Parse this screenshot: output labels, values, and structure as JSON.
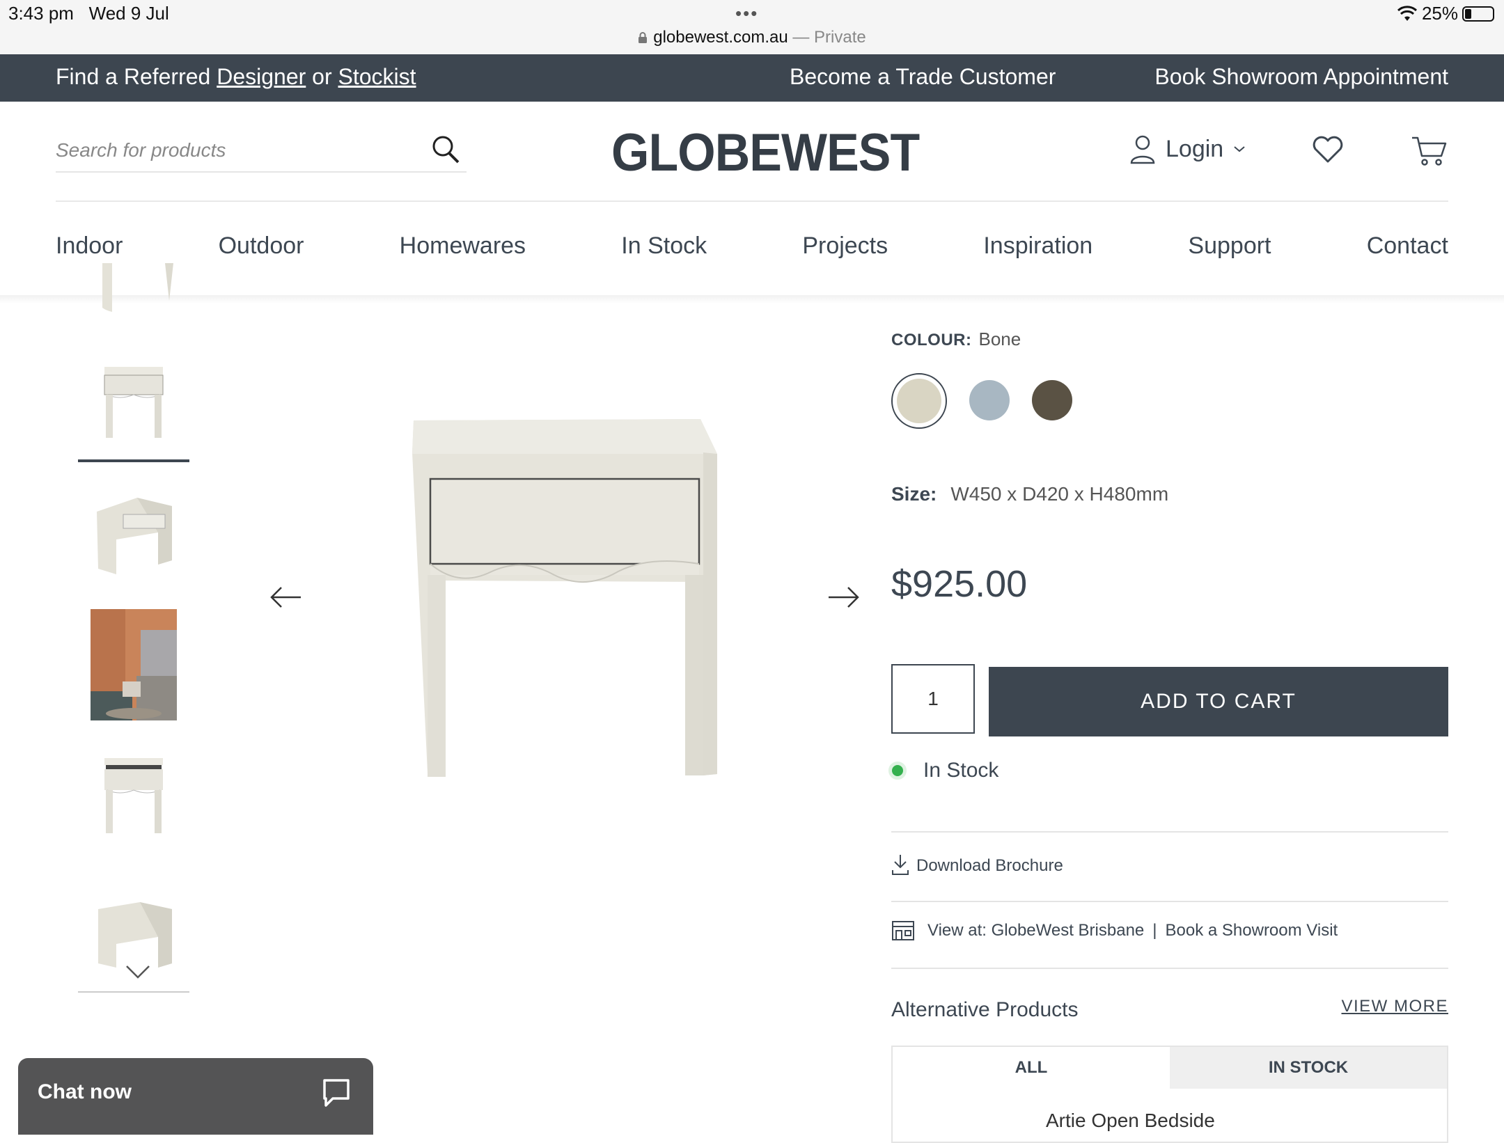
{
  "status_bar": {
    "time": "3:43 pm",
    "date": "Wed 9 Jul",
    "url": "globewest.com.au",
    "privacy": "— Private",
    "battery": "25%"
  },
  "promo": {
    "prefix": "Find a Referred ",
    "designer": "Designer",
    "or": " or ",
    "stockist": "Stockist",
    "trade": "Become a Trade Customer",
    "showroom": "Book Showroom Appointment"
  },
  "header": {
    "search_placeholder": "Search for products",
    "logo": "GLOBEWEST",
    "login": "Login"
  },
  "nav": [
    "Indoor",
    "Outdoor",
    "Homewares",
    "In Stock",
    "Projects",
    "Inspiration",
    "Support",
    "Contact"
  ],
  "product": {
    "colour_label": "COLOUR:",
    "colour_value": "Bone",
    "swatches": [
      "#d9d5c3",
      "#a8b7c2",
      "#5a5244"
    ],
    "size_label": "Size:",
    "size_value": "W450 x D420 x H480mm",
    "price": "$925.00",
    "quantity": "1",
    "add_to_cart": "ADD TO CART",
    "stock_status": "In Stock",
    "download": "Download Brochure",
    "view_at": "View at: GlobeWest Brisbane",
    "book_visit": "Book a Showroom Visit"
  },
  "alternatives": {
    "title": "Alternative Products",
    "view_more": "VIEW MORE",
    "tabs": [
      "ALL",
      "IN STOCK"
    ],
    "first_item": "Artie Open Bedside"
  },
  "chat": {
    "label": "Chat now"
  }
}
